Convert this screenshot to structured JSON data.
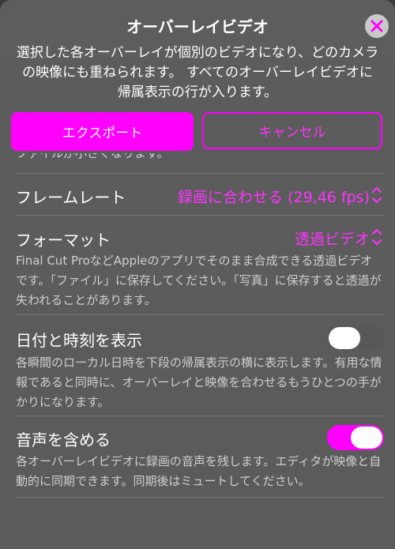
{
  "sheet": {
    "title": "オーバーレイビデオ",
    "subtitle": "選択した各オーバーレイが個別のビデオになり、どのカメラの映像にも重ねられます。 すべてのオーバーレイビデオに帰属表示の行が入ります。",
    "close_icon": "close-x-icon"
  },
  "buttons": {
    "export_label": "エクスポート",
    "cancel_label": "キャンセル"
  },
  "scrolled_partial_text": "ファイルが小さくなります。",
  "settings": {
    "frame_rate": {
      "label": "フレームレート",
      "value": "録画に合わせる (29,46 fps)"
    },
    "format": {
      "label": "フォーマット",
      "value": "透過ビデオ",
      "description": "Final Cut ProなどAppleのアプリでそのまま合成できる透過ビデオです。「ファイル」に保存してください。「写真」に保存すると透過が失われることがあります。"
    },
    "datetime": {
      "label": "日付と時刻を表示",
      "enabled": false,
      "description": "各瞬間のローカル日時を下段の帰属表示の横に表示します。有用な情報であると同時に、オーバーレイと映像を合わせるもうひとつの手がかりになります。"
    },
    "audio": {
      "label": "音声を含める",
      "enabled": true,
      "description": "各オーバーレイビデオに録画の音声を残します。エディタが映像と自動的に同期できます。同期後はミュートしてください。"
    }
  },
  "colors": {
    "accent": "#ff00ff",
    "sheet": "#606060",
    "toggle_off": "#585858"
  }
}
